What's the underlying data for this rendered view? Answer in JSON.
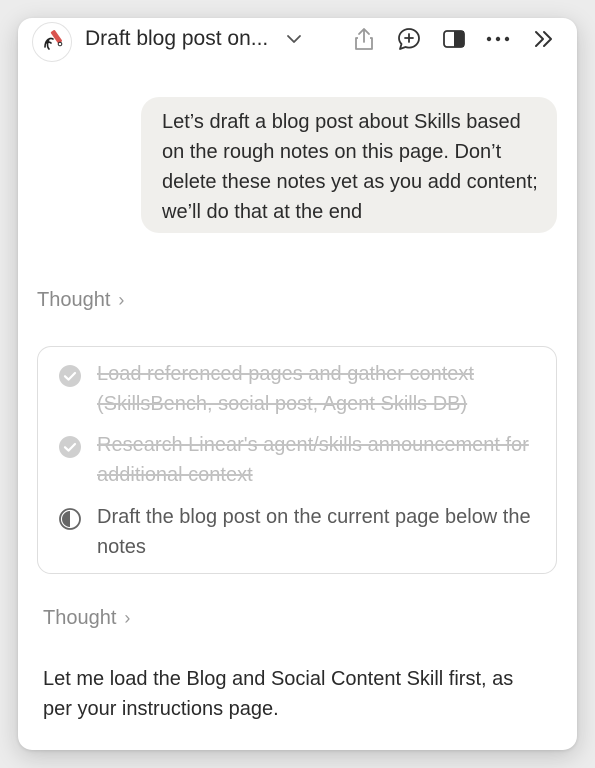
{
  "header": {
    "title": "Draft blog post on...",
    "icons": [
      "share-icon",
      "add-comment-icon",
      "sidebar-toggle-icon",
      "more-icon",
      "collapse-icon"
    ]
  },
  "message": {
    "text": "Let’s draft a blog post about Skills based on the rough notes on this page. Don’t delete these notes yet as you add content; we’ll do that at the end"
  },
  "thought_1": {
    "label": "Thought",
    "chevron": "›"
  },
  "tasks": [
    {
      "label": "Load referenced pages and gather context (SkillsBench, social post, Agent Skills DB)",
      "status": "done"
    },
    {
      "label": "Research Linear's agent/skills announcement for additional context",
      "status": "done"
    },
    {
      "label": "Draft the blog post on the current page below the notes",
      "status": "in-progress"
    }
  ],
  "thought_2": {
    "label": "Thought",
    "chevron": "›"
  },
  "reply": {
    "text": "Let me load the Blog and Social Content Skill first, as per your instructions page."
  }
}
